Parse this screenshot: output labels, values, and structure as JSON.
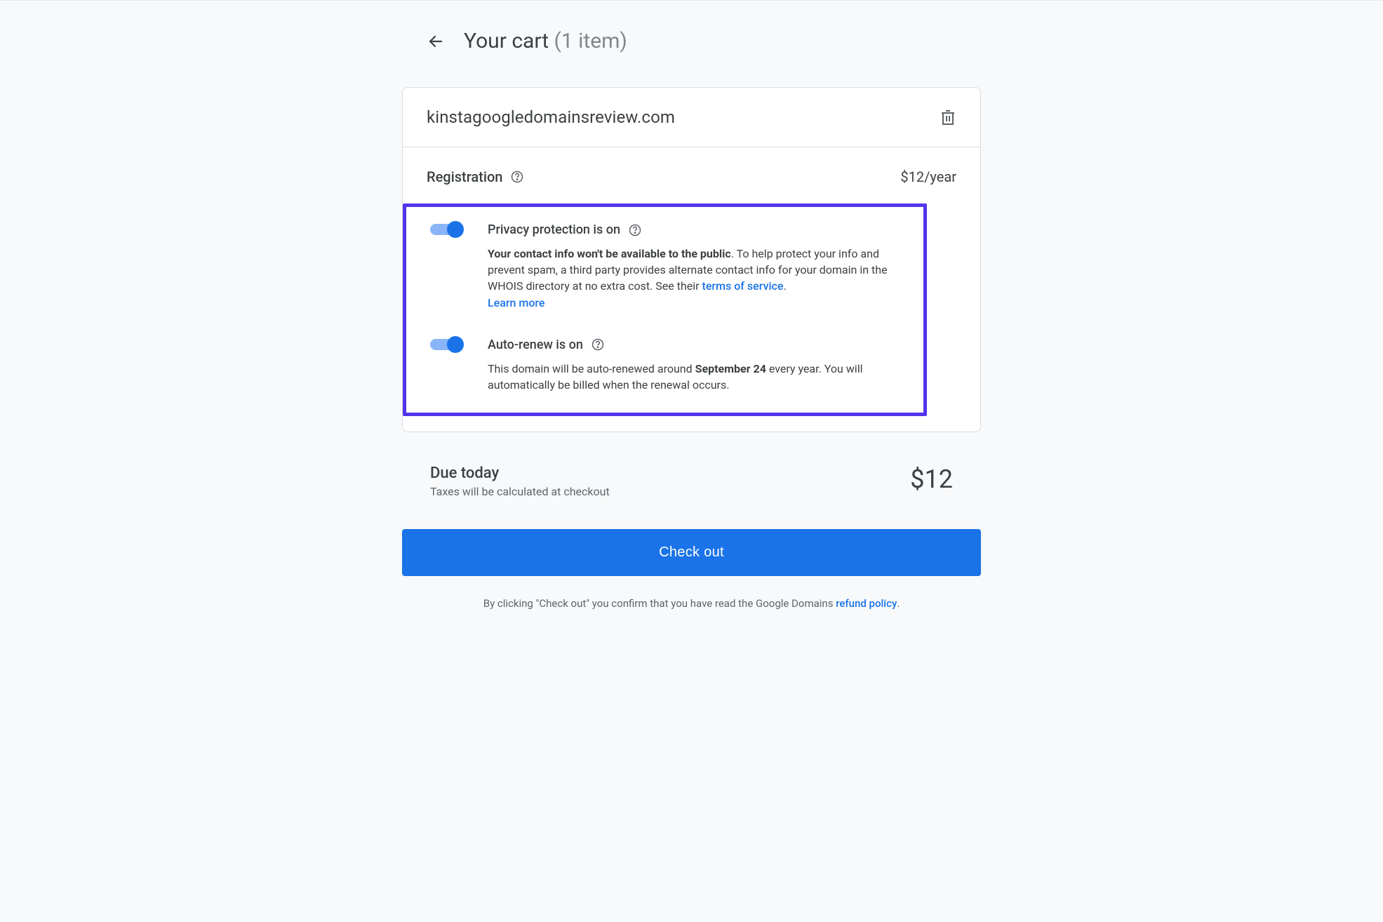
{
  "header": {
    "title": "Your cart",
    "count_label": "(1 item)"
  },
  "cart": {
    "domain": "kinstagoogledomainsreview.com",
    "registration_label": "Registration",
    "price": "$12/year"
  },
  "options": {
    "privacy": {
      "title": "Privacy protection is on",
      "desc_bold": "Your contact info won't be available to the public",
      "desc_rest": ". To help protect your info and prevent spam, a third party provides alternate contact info for your domain in the WHOIS directory at no extra cost. See their ",
      "tos_link": "terms of service",
      "period": ". ",
      "learn_more": "Learn more"
    },
    "autorenew": {
      "title": "Auto-renew is on",
      "desc_a": "This domain will be auto-renewed around ",
      "date": "September 24",
      "desc_b": " every year. You will automatically be billed when the renewal occurs."
    }
  },
  "due": {
    "title": "Due today",
    "sub": "Taxes will be calculated at checkout",
    "amount": "$12"
  },
  "checkout_label": "Check out",
  "disclaimer": {
    "text": "By clicking \"Check out\" you confirm that you have read the Google Domains ",
    "link": "refund policy",
    "period": "."
  }
}
